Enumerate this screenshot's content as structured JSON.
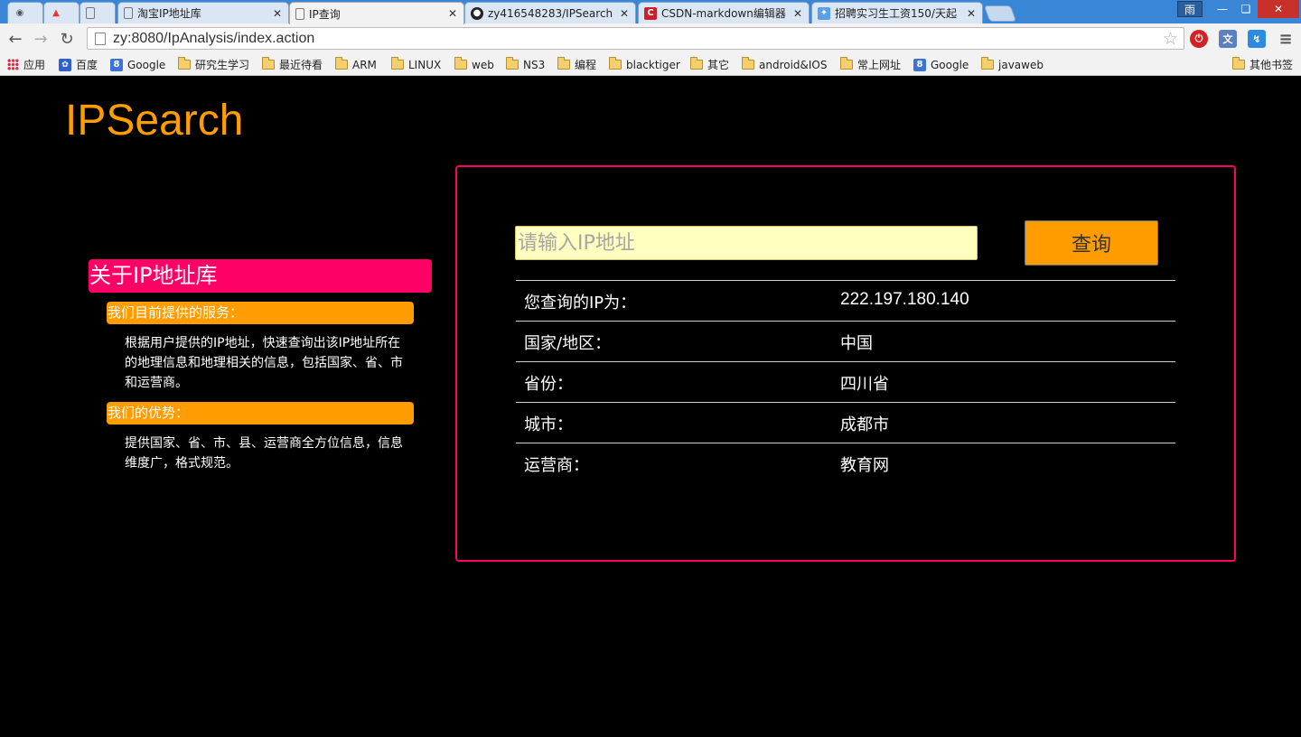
{
  "browser": {
    "tabs": [
      {
        "title": "",
        "icon": "fox-icon",
        "active": false
      },
      {
        "title": "",
        "icon": "flame-icon",
        "active": false
      },
      {
        "title": "",
        "icon": "page-icon",
        "active": false
      },
      {
        "title": "淘宝IP地址库",
        "icon": "page-icon",
        "active": false
      },
      {
        "title": "IP查询",
        "icon": "page-icon",
        "active": true
      },
      {
        "title": "zy416548283/IPSearch",
        "icon": "github-icon",
        "active": false
      },
      {
        "title": "CSDN-markdown编辑器",
        "icon": "csdn-icon",
        "active": false
      },
      {
        "title": "招聘实习生工资150/天起",
        "icon": "bird-icon",
        "active": false
      }
    ],
    "ime_label": "雨",
    "url": "zy:8080/IpAnalysis/index.action",
    "bookmarks": [
      {
        "label": "应用",
        "icon": "apps-grid-icon"
      },
      {
        "label": "百度",
        "icon": "baidu-paw-icon"
      },
      {
        "label": "Google",
        "icon": "google-icon"
      },
      {
        "label": "研究生学习",
        "icon": "folder-icon"
      },
      {
        "label": "最近待看",
        "icon": "folder-icon"
      },
      {
        "label": "ARM",
        "icon": "folder-icon"
      },
      {
        "label": "LINUX",
        "icon": "folder-icon"
      },
      {
        "label": "web",
        "icon": "folder-icon"
      },
      {
        "label": "NS3",
        "icon": "folder-icon"
      },
      {
        "label": "编程",
        "icon": "folder-icon"
      },
      {
        "label": "blacktiger",
        "icon": "folder-icon"
      },
      {
        "label": "其它",
        "icon": "folder-icon"
      },
      {
        "label": "android&IOS",
        "icon": "folder-icon"
      },
      {
        "label": "常上网址",
        "icon": "folder-icon"
      },
      {
        "label": "Google",
        "icon": "google-icon"
      },
      {
        "label": "javaweb",
        "icon": "folder-icon"
      }
    ],
    "other_bookmarks": "其他书签"
  },
  "page": {
    "logo": "IPSearch",
    "about": {
      "title": "关于IP地址库",
      "services_heading": "我们目前提供的服务：",
      "services_text": "根据用户提供的IP地址，快速查询出该IP地址所在的地理信息和地理相关的信息，包括国家、省、市和运营商。",
      "advantages_heading": "我们的优势：",
      "advantages_text": "提供国家、省、市、县、运营商全方位信息，信息维度广，格式规范。"
    },
    "search": {
      "placeholder": "请输入IP地址",
      "value": "",
      "button_label": "查询"
    },
    "results": [
      {
        "label": "您查询的IP为：",
        "value": "222.197.180.140"
      },
      {
        "label": "国家/地区：",
        "value": "中国"
      },
      {
        "label": "省份：",
        "value": "四川省"
      },
      {
        "label": "城市：",
        "value": "成都市"
      },
      {
        "label": "运营商：",
        "value": "教育网"
      }
    ]
  },
  "colors": {
    "accent_orange": "#ff9c00",
    "accent_pink": "#ff0066",
    "input_bg": "#ffffc0",
    "page_bg": "#000000"
  }
}
